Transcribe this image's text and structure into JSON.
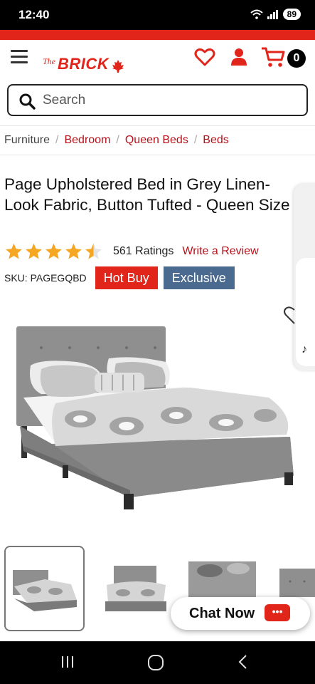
{
  "status_bar": {
    "time": "12:40",
    "battery": "89"
  },
  "header": {
    "logo_the": "The",
    "logo_brick": "BRICK",
    "cart_count": "0"
  },
  "search": {
    "placeholder": "Search",
    "value": ""
  },
  "breadcrumb": [
    {
      "label": "Furniture"
    },
    {
      "label": "Bedroom"
    },
    {
      "label": "Queen Beds"
    },
    {
      "label": "Beds"
    }
  ],
  "product": {
    "title": "Page Upholstered Bed in Grey Linen-Look Fabric, Button Tufted - Queen Size",
    "rating": 4.5,
    "rating_max": 5,
    "ratings_count": "561 Ratings",
    "write_review": "Write a Review",
    "sku": "SKU: PAGEGQBD",
    "badges": {
      "hot_buy": "Hot Buy",
      "exclusive": "Exclusive"
    }
  },
  "thumbnails": {
    "count_visible": 4,
    "active_index": 0
  },
  "chat": {
    "label": "Chat Now",
    "bubble": "•••"
  },
  "colors": {
    "brand_red": "#e1251b",
    "link_red": "#b5121b",
    "exclusive_blue": "#4b6a8f"
  },
  "icons": [
    "hamburger-icon",
    "heart-icon",
    "account-icon",
    "cart-icon",
    "search-icon",
    "star-icon",
    "chat-icon",
    "recents-icon",
    "home-icon",
    "back-icon"
  ]
}
